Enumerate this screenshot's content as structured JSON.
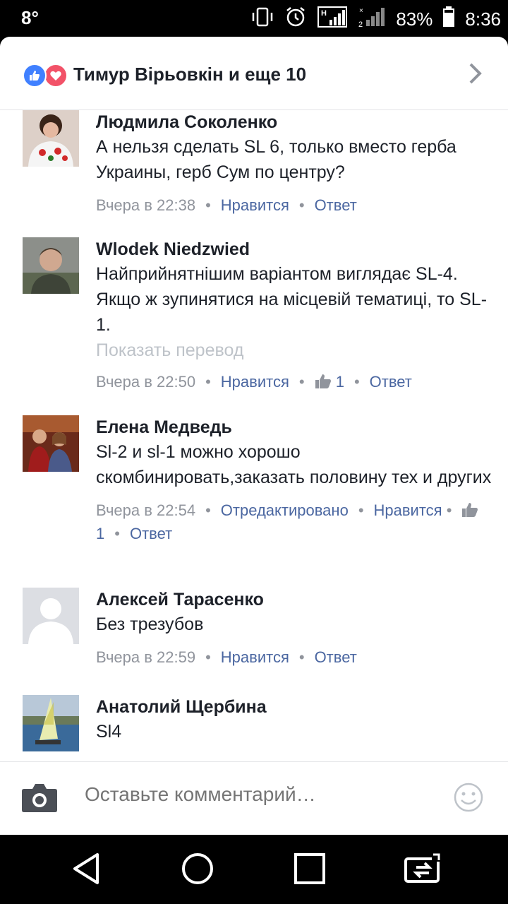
{
  "status_bar": {
    "notification": "8°",
    "battery": "83%",
    "time": "8:36",
    "signal_label": "H"
  },
  "header": {
    "title": "Тимур Вірьовкін и еще 10",
    "reactions": [
      "like-icon",
      "love-icon"
    ]
  },
  "comments": [
    {
      "name": "Людмила Соколенко",
      "text": "А нельзя сделать SL 6, только вместо герба Украины, герб Сум по центру?",
      "time": "Вчера в 22:38",
      "like_label": "Нравится",
      "reply_label": "Ответ"
    },
    {
      "name": "Wlodek Niedzwied",
      "text": "Найприйнятнішим варіантом виглядає SL-4. Якщо ж зупинятися на місцевій тематиці, то SL-1.",
      "translate": "Показать перевод",
      "time": "Вчера в 22:50",
      "like_label": "Нравится",
      "like_count": "1",
      "reply_label": "Ответ"
    },
    {
      "name": "Елена Медведь",
      "text": "Sl-2 и sl-1 можно хорошо скомбинировать,заказать половину тех и других",
      "time": "Вчера в 22:54",
      "edited": "Отредактировано",
      "like_label": "Нравится",
      "like_count": "1",
      "reply_label": "Ответ"
    },
    {
      "name": "Алексей Тарасенко",
      "text": "Без трезубов",
      "time": "Вчера в 22:59",
      "like_label": "Нравится",
      "reply_label": "Ответ"
    },
    {
      "name": "Анатолий Щербина",
      "text": "Sl4"
    }
  ],
  "composer": {
    "placeholder": "Оставьте комментарий…",
    "camera_icon": "camera-icon",
    "emoji_icon": "smiley-icon"
  },
  "nav": [
    "back-icon",
    "home-icon",
    "recents-icon",
    "screen-share-icon"
  ],
  "colors": {
    "link": "#4b67a1",
    "meta": "#90949c",
    "like": "#4080ff",
    "love": "#f25268"
  }
}
